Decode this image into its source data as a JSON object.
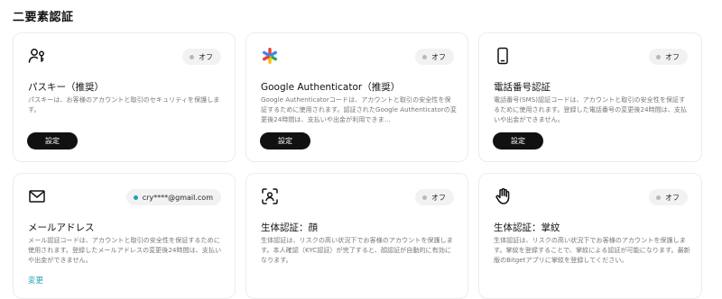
{
  "page": {
    "title": "二要素認証"
  },
  "colors": {
    "accent": "#1da2b4",
    "button": "#111111",
    "badge_bg": "#f2f2f2",
    "off_dot": "#b9b9b9"
  },
  "cards": [
    {
      "icon": "passkey-icon",
      "status": "オフ",
      "title": "パスキー（推奨）",
      "desc": "パスキーは、お客様のアカウントと取引のセキュリティを保護します。",
      "action": "設定"
    },
    {
      "icon": "google-authenticator-icon",
      "status": "オフ",
      "title": "Google Authenticator（推奨）",
      "desc": "Google Authenticatorコードは、アカウントと取引の安全性を保証するために使用されます。認証されたGoogle Authenticatorの変更後24時間は、支払いや出金が利用できま...",
      "action": "設定"
    },
    {
      "icon": "phone-icon",
      "status": "オフ",
      "title": "電話番号認証",
      "desc": "電話番号(SMS)認証コードは、アカウントと取引の安全性を保証するために使用されます。登録した電話番号の変更後24時間は、支払いや出金ができません。",
      "action": "設定"
    },
    {
      "icon": "mail-icon",
      "status": "cry****@gmail.com",
      "title": "メールアドレス",
      "desc": "メール認証コードは、アカウントと取引の安全性を保証するために使用されます。登録したメールアドレスの変更後24時間は、支払いや出金ができません。",
      "action": "変更"
    },
    {
      "icon": "face-scan-icon",
      "status": "オフ",
      "title": "生体認証：顔",
      "desc": "生体認証は、リスクの高い状況下でお客様のアカウントを保護します。本人確認（KYC認証）が完了すると、顔認証が自動的に有効になります。"
    },
    {
      "icon": "palm-icon",
      "status": "オフ",
      "title": "生体認証：掌紋",
      "desc": "生体認証は、リスクの高い状況下でお客様のアカウントを保護します。掌紋を登録することで、掌紋による認証が可能になります。最新版のBitgetアプリに掌紋を登録してください。"
    }
  ]
}
